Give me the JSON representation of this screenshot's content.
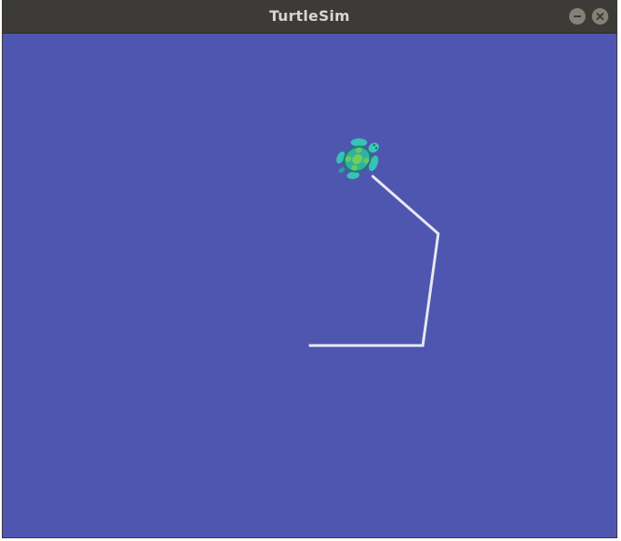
{
  "window": {
    "title": "TurtleSim",
    "buttons": [
      "minimize-button",
      "close-button"
    ]
  },
  "colors": {
    "titlebar": "#3d3b37",
    "title_text": "#d8d6d0",
    "canvas_background": "#4f56b0",
    "pen": "#e8e8f4",
    "turtle_shell": "#2fb3a0",
    "turtle_pattern": "#7fd14a"
  },
  "turtle": {
    "icon": "turtle-icon"
  }
}
